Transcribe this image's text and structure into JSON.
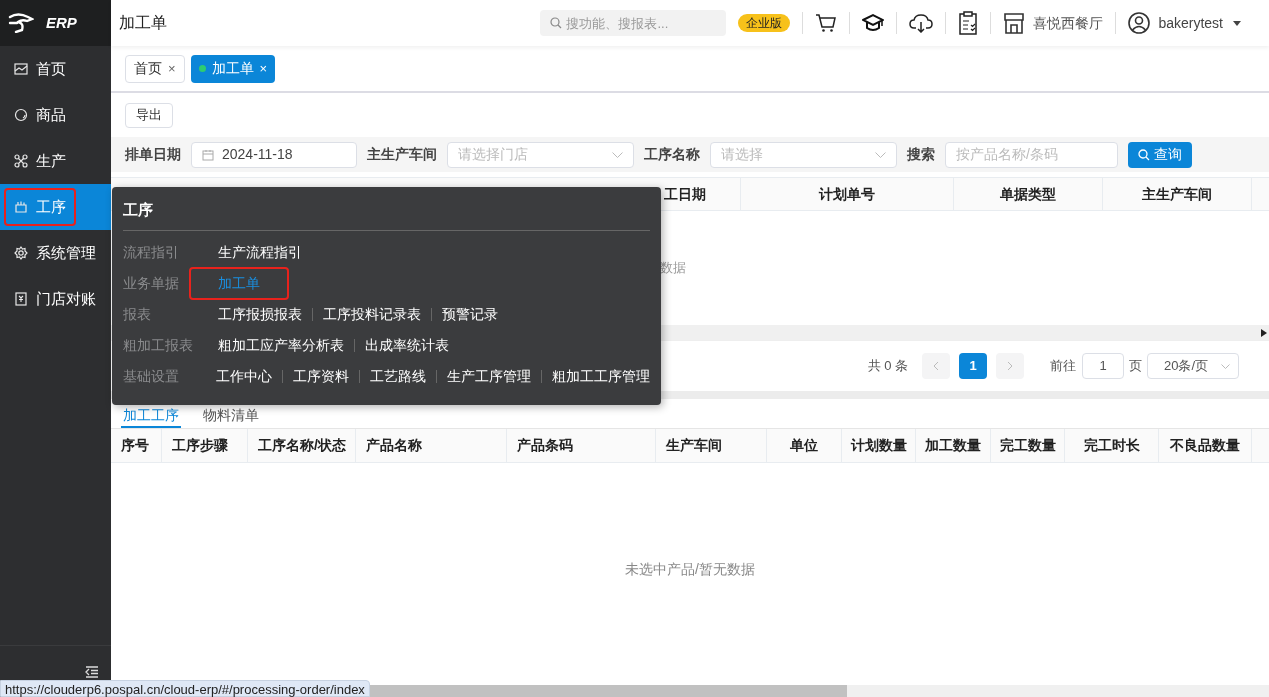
{
  "logo": {
    "text": "ERP"
  },
  "sidebar": {
    "items": [
      {
        "label": "首页",
        "selected": false,
        "highlighted": false
      },
      {
        "label": "商品",
        "selected": false,
        "highlighted": false
      },
      {
        "label": "生产",
        "selected": false,
        "highlighted": false
      },
      {
        "label": "工序",
        "selected": true,
        "highlighted": true
      },
      {
        "label": "系统管理",
        "selected": false,
        "highlighted": false
      },
      {
        "label": "门店对账",
        "selected": false,
        "highlighted": false
      }
    ]
  },
  "header": {
    "title": "加工单",
    "search": {
      "placeholder": "搜功能、搜报表..."
    },
    "badge": "企业版",
    "store": "喜悦西餐厅",
    "user": "bakerytest"
  },
  "tabs": [
    {
      "label": "首页",
      "close": "×",
      "selected": false
    },
    {
      "label": "加工单",
      "close": "×",
      "selected": true
    }
  ],
  "toolbar": {
    "export_button": "导出"
  },
  "filters": [
    {
      "label": "排单日期",
      "kind": "date",
      "value": "2024-11-18"
    },
    {
      "label": "主生产车间",
      "kind": "select",
      "placeholder": "请选择门店"
    },
    {
      "label": "工序名称",
      "kind": "select",
      "placeholder": "请选择"
    },
    {
      "label": "搜索",
      "kind": "text",
      "placeholder": "按产品名称/条码"
    }
  ],
  "query_button": "查询",
  "orders_table": {
    "columns": [
      "工日期",
      "计划单号",
      "单据类型",
      "主生产车间"
    ],
    "empty_text": "数据"
  },
  "pagination": {
    "total": "共 0 条",
    "pages": [
      {
        "label": "1",
        "selected": true
      }
    ],
    "goto_label": "前往",
    "goto_value": "1",
    "page_unit": "页",
    "page_size": "20条/页"
  },
  "detail_tabs": [
    {
      "label": "加工工序",
      "selected": true
    },
    {
      "label": "物料清单",
      "selected": false
    }
  ],
  "detail_table": {
    "columns": [
      "序号",
      "工序步骤",
      "工序名称/状态",
      "产品名称",
      "产品条码",
      "生产车间",
      "单位",
      "计划数量",
      "加工数量",
      "完工数量",
      "完工时长",
      "不良品数量"
    ],
    "empty_text": "未选中产品/暂无数据"
  },
  "menu_popup": {
    "title": "工序",
    "groups": [
      {
        "label": "流程指引",
        "links": [
          {
            "label": "生产流程指引",
            "selected": false,
            "highlighted": false
          }
        ]
      },
      {
        "label": "业务单据",
        "links": [
          {
            "label": "加工单",
            "selected": true,
            "highlighted": true
          }
        ]
      },
      {
        "label": "报表",
        "links": [
          {
            "label": "工序报损报表",
            "selected": false,
            "highlighted": false
          },
          {
            "label": "工序投料记录表",
            "selected": false,
            "highlighted": false
          },
          {
            "label": "预警记录",
            "selected": false,
            "highlighted": false
          }
        ]
      },
      {
        "label": "粗加工报表",
        "links": [
          {
            "label": "粗加工应产率分析表",
            "selected": false,
            "highlighted": false
          },
          {
            "label": "出成率统计表",
            "selected": false,
            "highlighted": false
          }
        ]
      },
      {
        "label": "基础设置",
        "links": [
          {
            "label": "工作中心",
            "selected": false,
            "highlighted": false
          },
          {
            "label": "工序资料",
            "selected": false,
            "highlighted": false
          },
          {
            "label": "工艺路线",
            "selected": false,
            "highlighted": false
          },
          {
            "label": "生产工序管理",
            "selected": false,
            "highlighted": false
          },
          {
            "label": "粗加工工序管理",
            "selected": false,
            "highlighted": false
          }
        ]
      }
    ]
  },
  "status_url": "https://clouderp6.pospal.cn/cloud-erp/#/processing-order/index"
}
